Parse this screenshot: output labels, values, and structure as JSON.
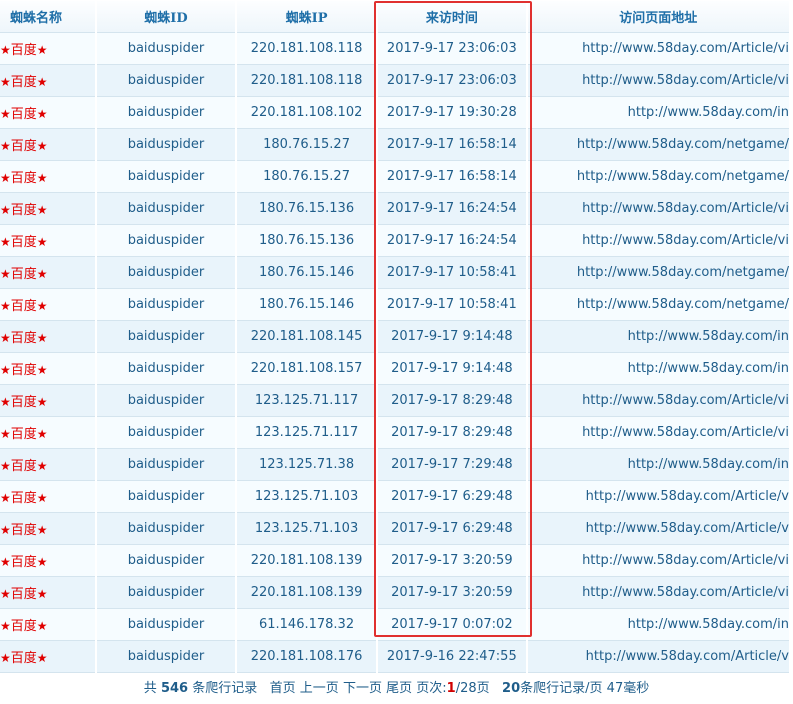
{
  "headers": {
    "name": "蜘蛛名称",
    "spider_id": "蜘蛛ID",
    "spider_ip": "蜘蛛IP",
    "visit_time": "来访时间",
    "url": "访问页面地址"
  },
  "rows": [
    {
      "name": "百度",
      "id": "baiduspider",
      "ip": "220.181.108.118",
      "time": "2017-9-17 23:06:03",
      "url": "http://www.58day.com/Article/vi"
    },
    {
      "name": "百度",
      "id": "baiduspider",
      "ip": "220.181.108.118",
      "time": "2017-9-17 23:06:03",
      "url": "http://www.58day.com/Article/vi"
    },
    {
      "name": "百度",
      "id": "baiduspider",
      "ip": "220.181.108.102",
      "time": "2017-9-17 19:30:28",
      "url": "http://www.58day.com/in"
    },
    {
      "name": "百度",
      "id": "baiduspider",
      "ip": "180.76.15.27",
      "time": "2017-9-17 16:58:14",
      "url": "http://www.58day.com/netgame/"
    },
    {
      "name": "百度",
      "id": "baiduspider",
      "ip": "180.76.15.27",
      "time": "2017-9-17 16:58:14",
      "url": "http://www.58day.com/netgame/"
    },
    {
      "name": "百度",
      "id": "baiduspider",
      "ip": "180.76.15.136",
      "time": "2017-9-17 16:24:54",
      "url": "http://www.58day.com/Article/vi"
    },
    {
      "name": "百度",
      "id": "baiduspider",
      "ip": "180.76.15.136",
      "time": "2017-9-17 16:24:54",
      "url": "http://www.58day.com/Article/vi"
    },
    {
      "name": "百度",
      "id": "baiduspider",
      "ip": "180.76.15.146",
      "time": "2017-9-17 10:58:41",
      "url": "http://www.58day.com/netgame/"
    },
    {
      "name": "百度",
      "id": "baiduspider",
      "ip": "180.76.15.146",
      "time": "2017-9-17 10:58:41",
      "url": "http://www.58day.com/netgame/"
    },
    {
      "name": "百度",
      "id": "baiduspider",
      "ip": "220.181.108.145",
      "time": "2017-9-17 9:14:48",
      "url": "http://www.58day.com/in"
    },
    {
      "name": "百度",
      "id": "baiduspider",
      "ip": "220.181.108.157",
      "time": "2017-9-17 9:14:48",
      "url": "http://www.58day.com/in"
    },
    {
      "name": "百度",
      "id": "baiduspider",
      "ip": "123.125.71.117",
      "time": "2017-9-17 8:29:48",
      "url": "http://www.58day.com/Article/vi"
    },
    {
      "name": "百度",
      "id": "baiduspider",
      "ip": "123.125.71.117",
      "time": "2017-9-17 8:29:48",
      "url": "http://www.58day.com/Article/vi"
    },
    {
      "name": "百度",
      "id": "baiduspider",
      "ip": "123.125.71.38",
      "time": "2017-9-17 7:29:48",
      "url": "http://www.58day.com/in"
    },
    {
      "name": "百度",
      "id": "baiduspider",
      "ip": "123.125.71.103",
      "time": "2017-9-17 6:29:48",
      "url": "http://www.58day.com/Article/v"
    },
    {
      "name": "百度",
      "id": "baiduspider",
      "ip": "123.125.71.103",
      "time": "2017-9-17 6:29:48",
      "url": "http://www.58day.com/Article/v"
    },
    {
      "name": "百度",
      "id": "baiduspider",
      "ip": "220.181.108.139",
      "time": "2017-9-17 3:20:59",
      "url": "http://www.58day.com/Article/vi"
    },
    {
      "name": "百度",
      "id": "baiduspider",
      "ip": "220.181.108.139",
      "time": "2017-9-17 3:20:59",
      "url": "http://www.58day.com/Article/vi"
    },
    {
      "name": "百度",
      "id": "baiduspider",
      "ip": "61.146.178.32",
      "time": "2017-9-17 0:07:02",
      "url": "http://www.58day.com/in"
    },
    {
      "name": "百度",
      "id": "baiduspider",
      "ip": "220.181.108.176",
      "time": "2017-9-16 22:47:55",
      "url": "http://www.58day.com/Article/v"
    }
  ],
  "star_glyph": "★",
  "footer": {
    "total_prefix": "共",
    "total_count": "546",
    "total_suffix": "条爬行记录",
    "first": "首页",
    "prev": "上一页",
    "next": "下一页",
    "last": "尾页",
    "page_label": "页次:",
    "current_page": "1",
    "total_pages": "/28页",
    "per_page": "20",
    "per_page_suffix": "条爬行记录/页",
    "elapsed": "47毫秒"
  },
  "colors": {
    "header_text": "#1f6fa8",
    "name_red": "#e00000",
    "row_odd": "#f6fcff",
    "row_even": "#e9f4fb",
    "highlight_border": "#e0302f"
  }
}
